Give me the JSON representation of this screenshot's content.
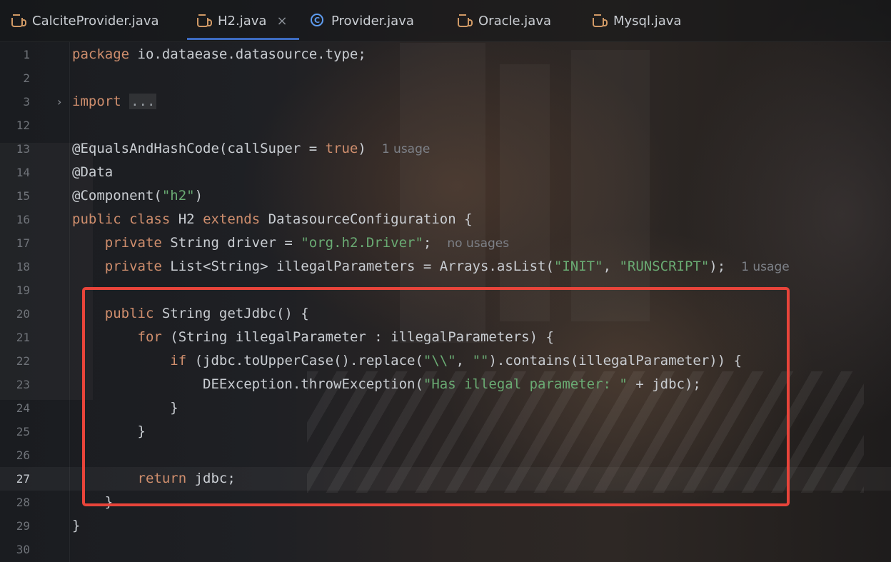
{
  "tabs": [
    {
      "label": "CalciteProvider.java",
      "icon": "java-file-icon"
    },
    {
      "label": "H2.java",
      "icon": "java-file-icon",
      "active": true,
      "closable": true
    },
    {
      "label": "Provider.java",
      "icon": "java-class-icon"
    },
    {
      "label": "Oracle.java",
      "icon": "java-file-icon"
    },
    {
      "label": "Mysql.java",
      "icon": "java-file-icon"
    }
  ],
  "close_glyph": "×",
  "line_numbers": [
    "1",
    "2",
    "3",
    "12",
    "13",
    "14",
    "15",
    "16",
    "17",
    "18",
    "19",
    "20",
    "21",
    "22",
    "23",
    "24",
    "25",
    "26",
    "27",
    "28",
    "29",
    "30"
  ],
  "code": {
    "l1": {
      "kw": "package",
      "rest": " io.dataease.datasource.type;"
    },
    "l3": {
      "kw": "import",
      "fold": "..."
    },
    "l13": {
      "ann": "@EqualsAndHashCode(callSuper = ",
      "kw": "true",
      "rest": ")",
      "hint": "1 usage"
    },
    "l14": {
      "ann": "@Data"
    },
    "l15": {
      "ann": "@Component(",
      "str": "\"h2\"",
      "rest": ")"
    },
    "l16": {
      "kw1": "public",
      "kw2": "class",
      "mid": " H2 ",
      "kw3": "extends",
      "rest": " DatasourceConfiguration {"
    },
    "l17": {
      "kw": "private",
      "mid": " String driver = ",
      "str": "\"org.h2.Driver\"",
      "rest": ";",
      "hint": "no usages"
    },
    "l18": {
      "kw": "private",
      "mid": " List<String> illegalParameters = Arrays.asList(",
      "str1": "\"INIT\"",
      "sep": ", ",
      "str2": "\"RUNSCRIPT\"",
      "rest": ");",
      "hint": "1 usage"
    },
    "l20": {
      "kw": "public",
      "rest": " String getJdbc() {"
    },
    "l21": {
      "kw": "for",
      "rest": " (String illegalParameter : illegalParameters) {"
    },
    "l22": {
      "kw": "if",
      "mid": " (jdbc.toUpperCase().replace(",
      "str1": "\"\\\\\"",
      "sep": ", ",
      "str2": "\"\"",
      "rest": ").contains(illegalParameter)) {"
    },
    "l23": {
      "mid": "DEException.throwException(",
      "str": "\"Has illegal parameter: \"",
      "rest": " + jdbc);"
    },
    "l24": {
      "rest": "}"
    },
    "l25": {
      "rest": "}"
    },
    "l27": {
      "kw": "return",
      "rest": " jdbc;"
    },
    "l28": {
      "rest": "}"
    },
    "l29": {
      "rest": "}"
    }
  },
  "fold_arrow": "›",
  "colors": {
    "keyword": "#cf8e6d",
    "string": "#6aab73",
    "text": "#c9cdd2",
    "highlight_box": "#e8443a",
    "tab_active": "#3d6bc0"
  }
}
